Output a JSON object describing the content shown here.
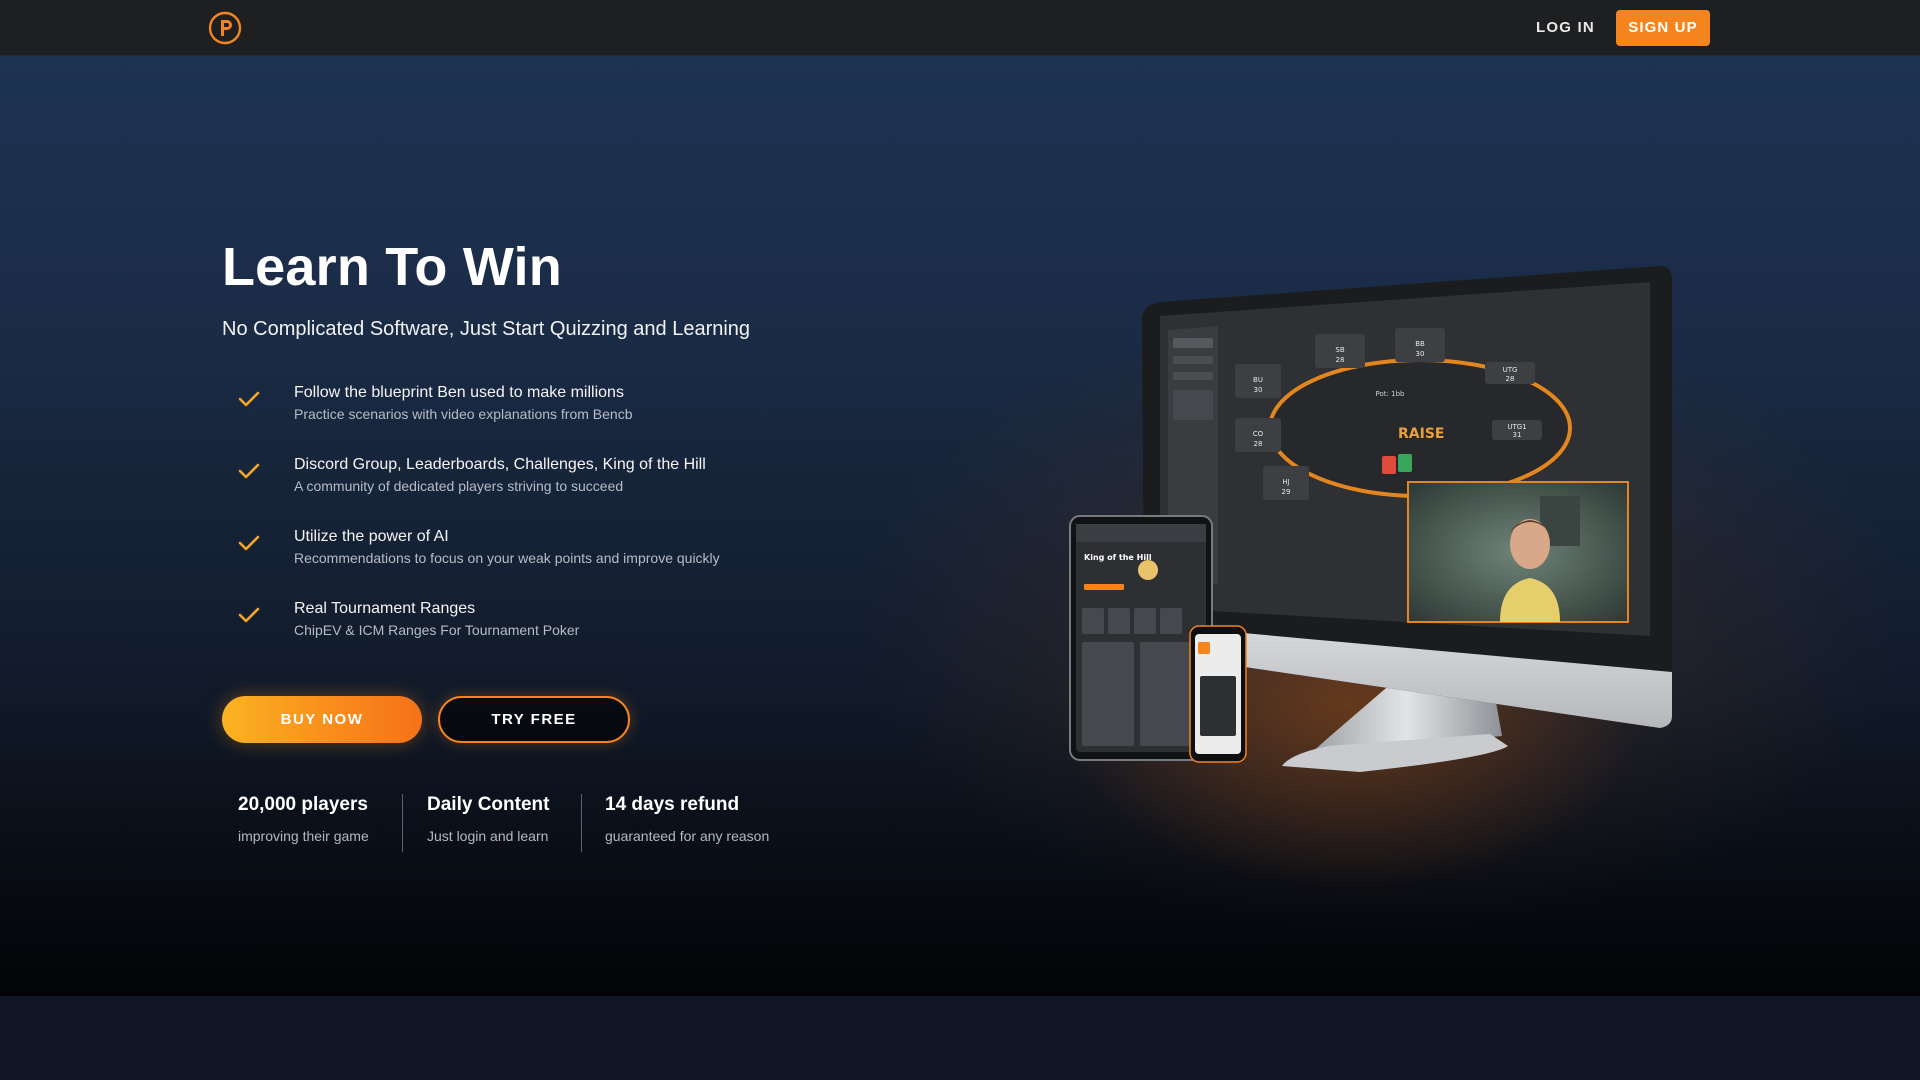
{
  "header": {
    "logo_icon": "poker-chip-logo-icon",
    "login_label": "LOG IN",
    "signup_label": "SIGN UP"
  },
  "hero": {
    "title": "Learn To Win",
    "subtitle": "No Complicated Software, Just Start Quizzing and Learning",
    "features": [
      {
        "icon": "check-icon",
        "title": "Follow the blueprint Ben used to make millions",
        "description": "Practice scenarios with video explanations from Bencb"
      },
      {
        "icon": "check-icon",
        "title": "Discord Group, Leaderboards, Challenges, King of the Hill",
        "description": "A community of dedicated players striving to succeed"
      },
      {
        "icon": "check-icon",
        "title": "Utilize the power of AI",
        "description": "Recommendations to focus on your weak points and improve quickly"
      },
      {
        "icon": "check-icon",
        "title": "Real Tournament Ranges",
        "description": "ChipEV & ICM Ranges For Tournament Poker"
      }
    ],
    "buy_label": "BUY NOW",
    "try_label": "TRY FREE",
    "stats": [
      {
        "value": "20,000 players",
        "label": "improving their game"
      },
      {
        "value": "Daily Content",
        "label": "Just login and learn"
      },
      {
        "value": "14 days refund",
        "label": "guaranteed for any reason"
      }
    ]
  },
  "illustration": {
    "brand_text": "RAISE",
    "tablet_heading": "King of the Hill",
    "seats": [
      {
        "pos": "SB",
        "stack": "28"
      },
      {
        "pos": "BB",
        "stack": "30"
      },
      {
        "pos": "UTG",
        "stack": "28"
      },
      {
        "pos": "BU",
        "stack": "30"
      },
      {
        "pos": "CO",
        "stack": "28"
      },
      {
        "pos": "UTG1",
        "stack": "31"
      },
      {
        "pos": "HJ",
        "stack": "29"
      }
    ],
    "pot_text": "Pot: 1bb"
  },
  "colors": {
    "accent": "#f5841f",
    "header_bg": "#1e1f21",
    "hero_top": "#1d3353",
    "hero_bottom": "#020305"
  }
}
